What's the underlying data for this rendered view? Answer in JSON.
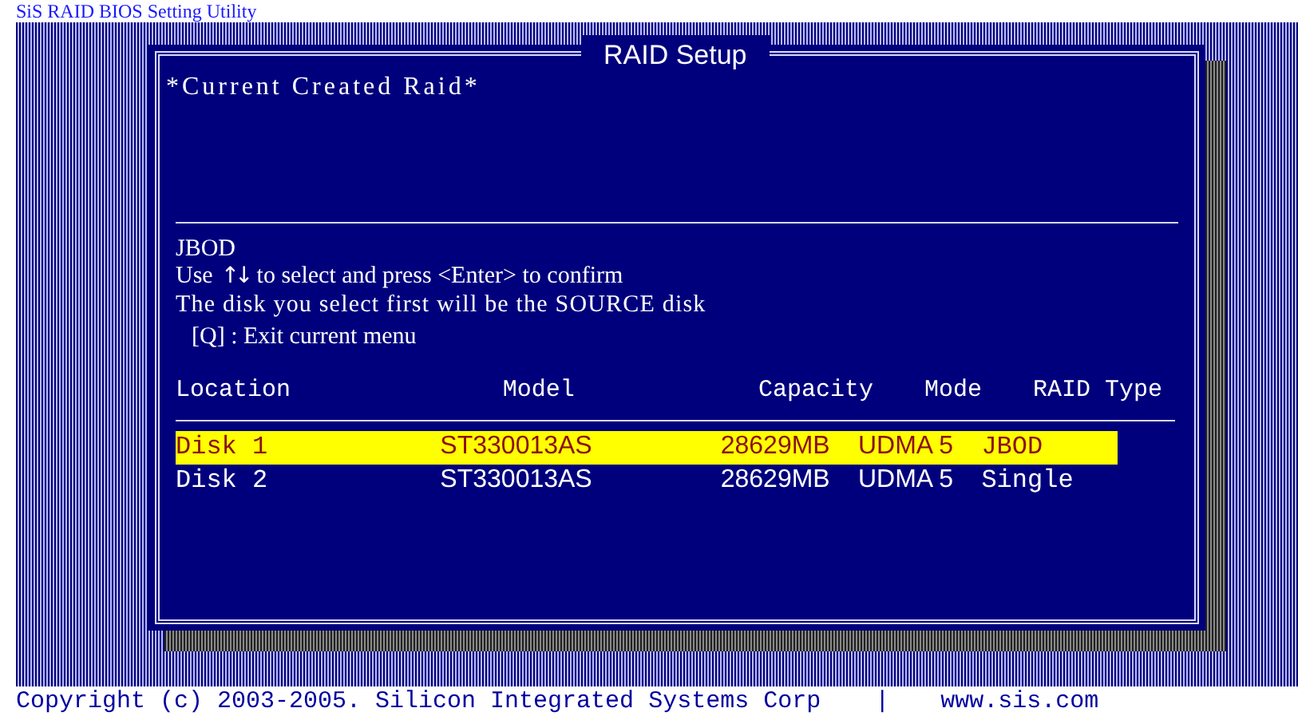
{
  "top_title": "SiS RAID BIOS Setting Utility",
  "dialog": {
    "title": "RAID Setup",
    "section_title": "*Current Created Raid*",
    "mode": "JBOD",
    "instructions": [
      {
        "kind": "arrows",
        "before": "Use",
        "arrows": "↑↓",
        "after": "to select and press <Enter> to confirm"
      },
      {
        "kind": "plain",
        "text": "The disk you select first will be the SOURCE disk"
      },
      {
        "kind": "plain",
        "text": "[Q] : Exit current menu"
      }
    ],
    "table": {
      "columns": [
        "Location",
        "Model",
        "Capacity",
        "Mode",
        "RAID Type"
      ],
      "rows": [
        {
          "cells": [
            "Disk 1",
            "ST330013AS",
            "28629MB",
            "UDMA 5",
            "JBOD"
          ],
          "selected": true
        },
        {
          "cells": [
            "Disk 2",
            "ST330013AS",
            "28629MB",
            "UDMA 5",
            "Single"
          ],
          "selected": false
        }
      ]
    }
  },
  "footer": {
    "copyright": "Copyright (c) 2003-2005. Silicon Integrated Systems Corp",
    "separator": "|",
    "url": "www.sis.com"
  }
}
